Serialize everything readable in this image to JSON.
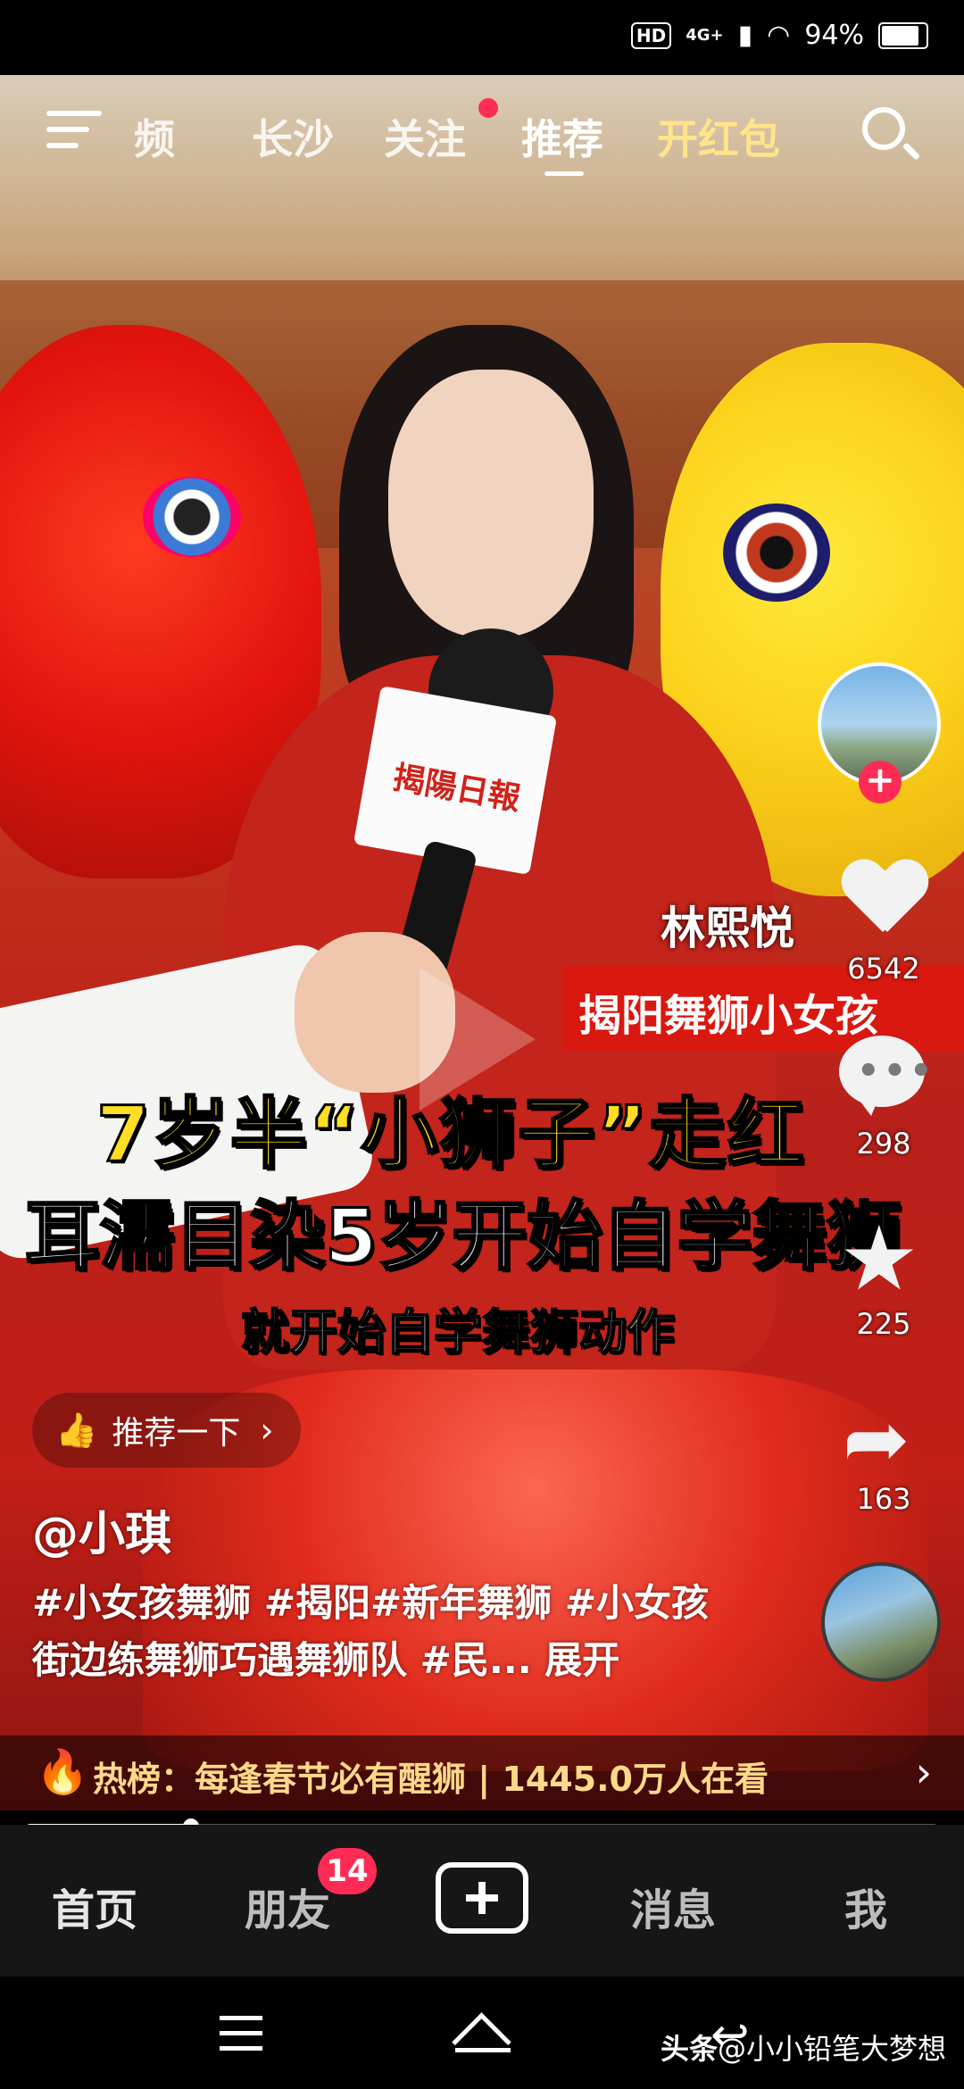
{
  "status_bar": {
    "hd": "HD",
    "network": "4G+",
    "battery": "94%",
    "battery_level": 0.94
  },
  "top_nav": {
    "tabs": [
      "频",
      "长沙",
      "关注",
      "推荐",
      "开红包"
    ],
    "active_tab": "推荐",
    "icons": [
      "menu-icon",
      "search-icon"
    ]
  },
  "captions": {
    "name": "林熙悦",
    "title": "揭阳舞狮小女孩",
    "headline_1": "7岁半“小狮子”走红",
    "headline_2": "耳濡目染5岁开始自学舞狮",
    "subtitle": "就开始自学舞狮动作",
    "mic_label": "揭陽日報"
  },
  "right_rail": {
    "likes": "6542",
    "comments": "298",
    "favorites": "225",
    "shares": "163"
  },
  "recommend": {
    "label": "推荐一下"
  },
  "post": {
    "author": "@小琪",
    "description": "#小女孩舞狮 #揭阳#新年舞狮 #小女孩街边练舞狮巧遇舞狮队 #民... 展开"
  },
  "hot_bar": {
    "text": "热榜：每逢春节必有醒狮 | 1445.0万人在看"
  },
  "progress": {
    "value": 0.18
  },
  "bottom_tabs": {
    "home": "首页",
    "friends": "朋友",
    "friends_badge": "14",
    "messages": "消息",
    "me": "我"
  },
  "watermark": {
    "brand": "头条",
    "handle": "@小小铅笔大梦想"
  }
}
